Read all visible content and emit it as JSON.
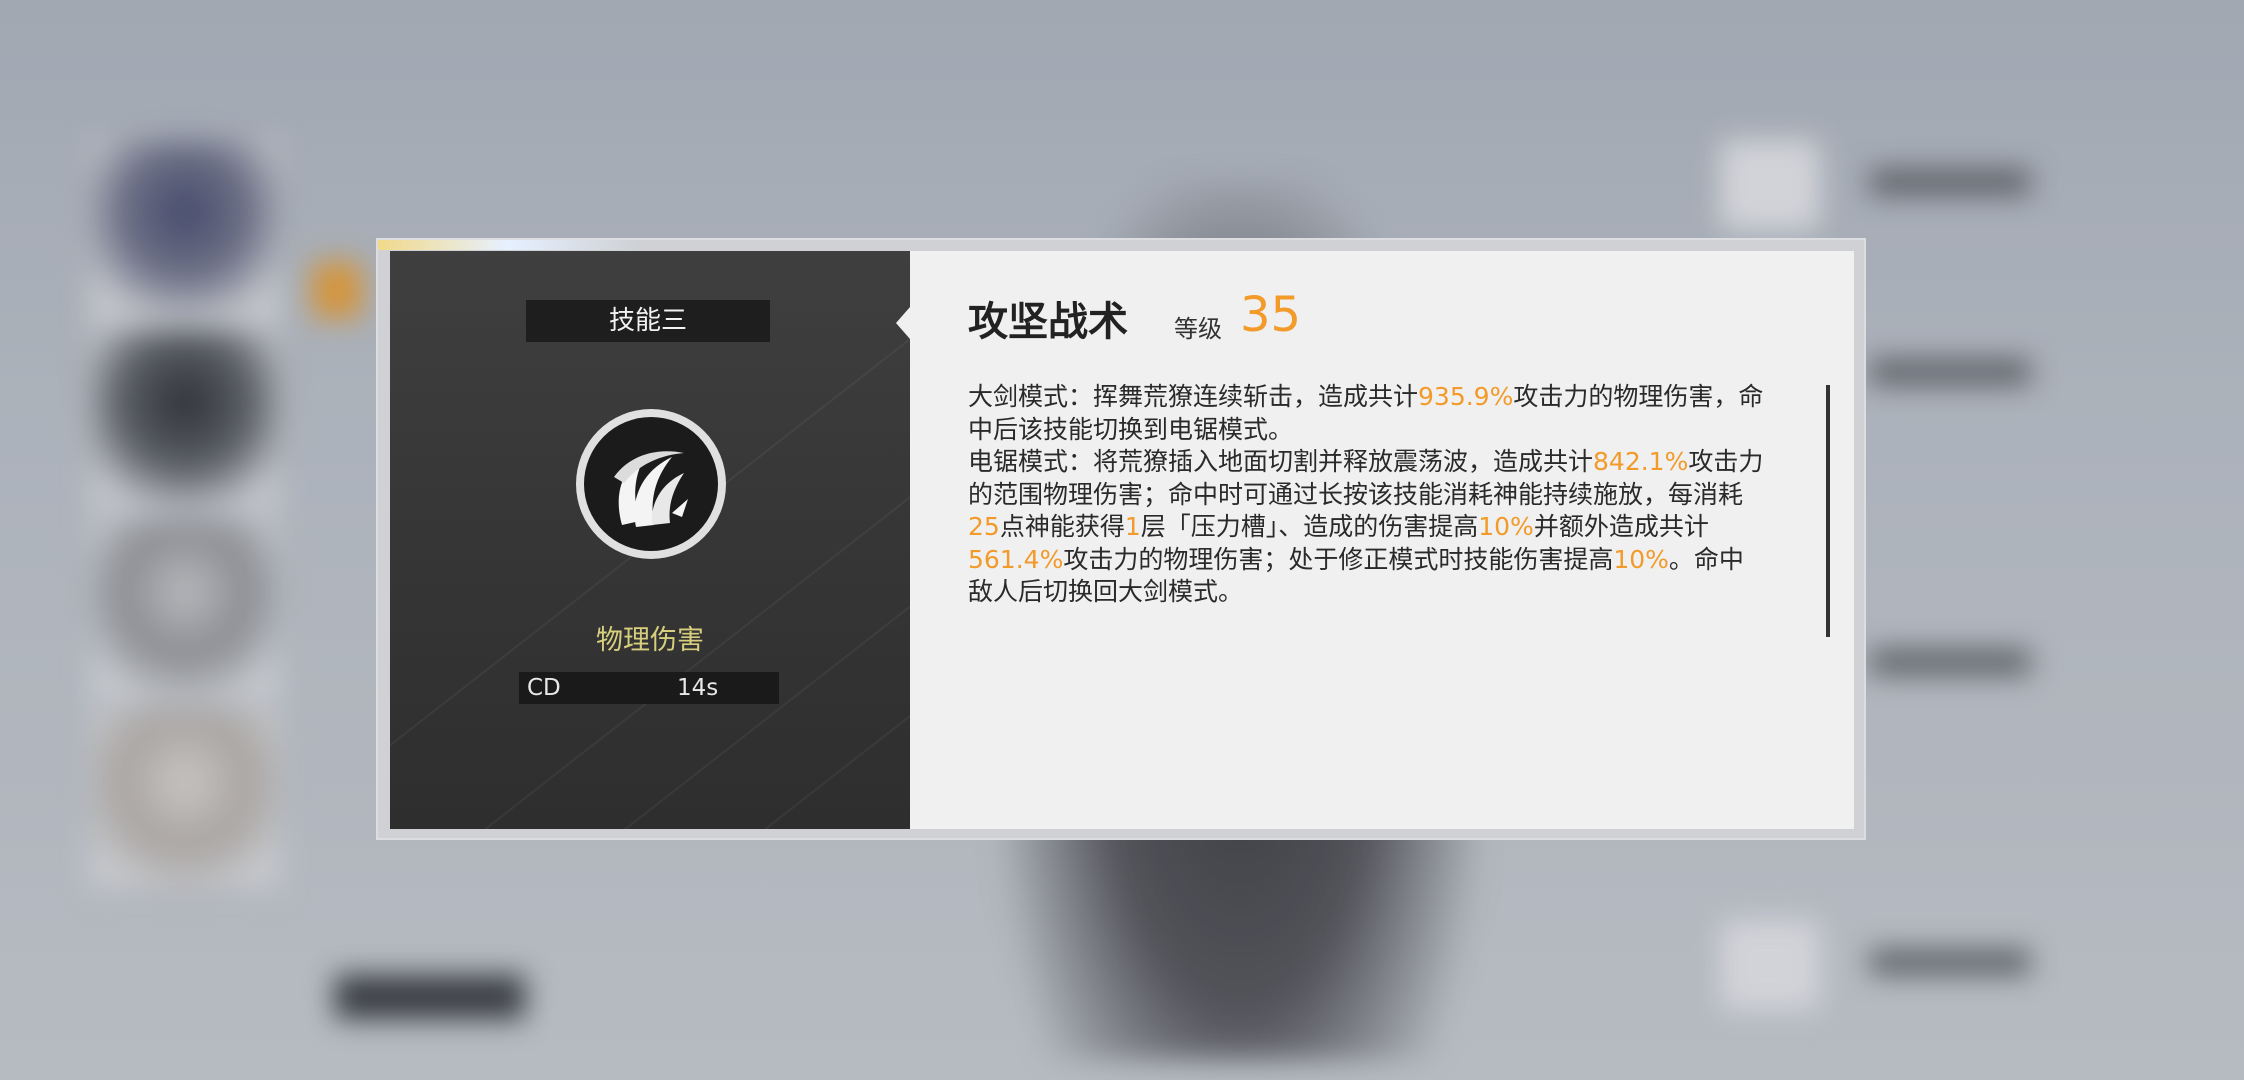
{
  "skill": {
    "tab_label": "技能三",
    "name": "攻坚战术",
    "level_label": "等级",
    "level_value": "35",
    "damage_type": "物理伤害",
    "cd_label": "CD",
    "cd_value": "14s",
    "icon": "claw-slash-icon"
  },
  "description": {
    "p1": [
      {
        "t": "大剑模式：挥舞荒獠连续斩击，造成共计",
        "h": false
      },
      {
        "t": "935.9%",
        "h": true
      },
      {
        "t": "攻击力的物理伤害，命中后该技能切换到电锯模式。",
        "h": false
      }
    ],
    "p2": [
      {
        "t": "电锯模式：将荒獠插入地面切割并释放震荡波，造成共计",
        "h": false
      },
      {
        "t": "842.1%",
        "h": true
      },
      {
        "t": "攻击力的范围物理伤害；命中时可通过长按该技能消耗神能持续施放，每消耗",
        "h": false
      },
      {
        "t": "25",
        "h": true
      },
      {
        "t": "点神能获得",
        "h": false
      },
      {
        "t": "1",
        "h": true
      },
      {
        "t": "层「压力槽」、造成的伤害提高",
        "h": false
      },
      {
        "t": "10%",
        "h": true
      },
      {
        "t": "并额外造成共计",
        "h": false
      },
      {
        "t": "561.4%",
        "h": true
      },
      {
        "t": "攻击力的物理伤害；处于修正模式时技能伤害提高",
        "h": false
      },
      {
        "t": "10%",
        "h": true
      },
      {
        "t": "。命中敌人后切换回大剑模式。",
        "h": false
      }
    ]
  },
  "colors": {
    "accent": "#f29a2a",
    "damage_type": "#d7cf7e",
    "panel_dark": "#3a3a3a",
    "panel_light": "#f0f0f0"
  }
}
